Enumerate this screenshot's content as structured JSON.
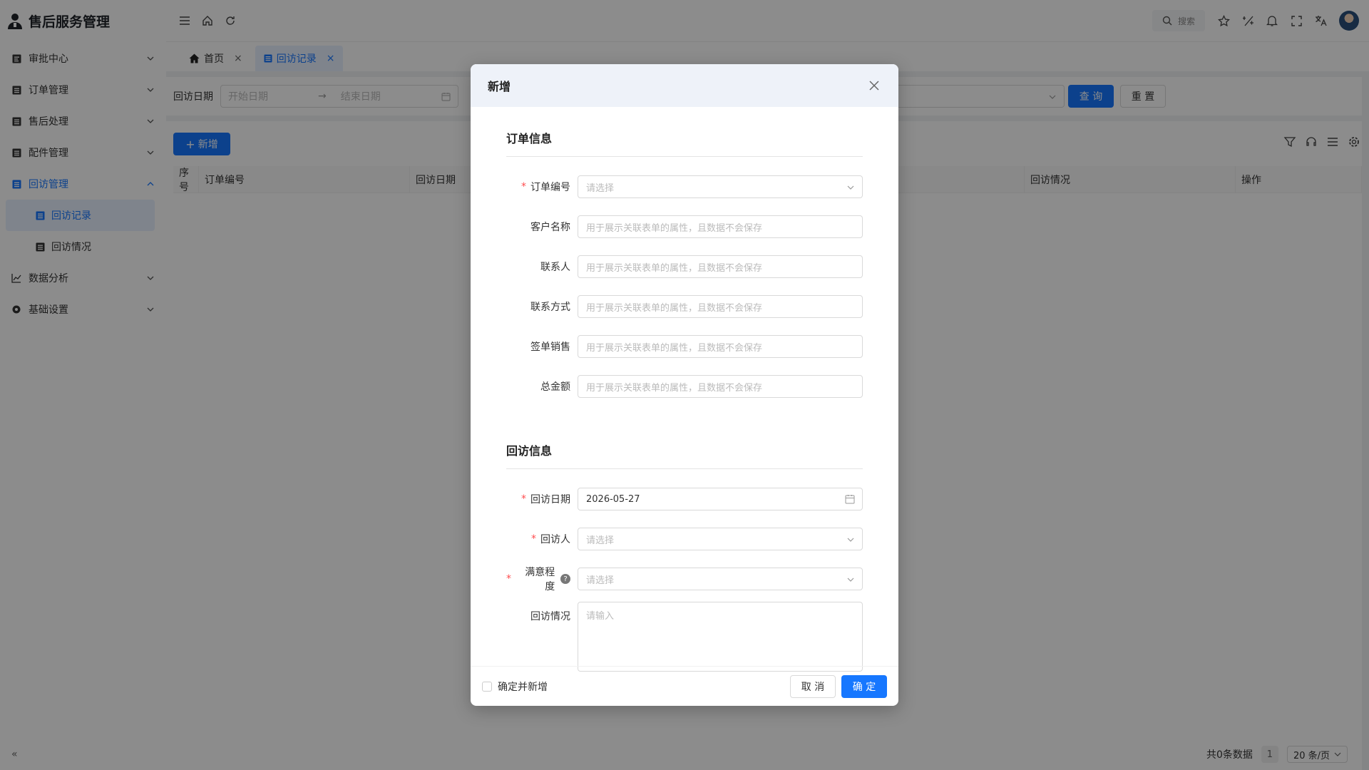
{
  "app": {
    "title": "售后服务管理"
  },
  "sidebar": {
    "items": [
      {
        "label": "审批中心",
        "icon": "approval-icon"
      },
      {
        "label": "订单管理",
        "icon": "document-icon"
      },
      {
        "label": "售后处理",
        "icon": "document-icon"
      },
      {
        "label": "配件管理",
        "icon": "document-icon"
      },
      {
        "label": "回访管理",
        "icon": "document-icon",
        "open": true,
        "children": [
          {
            "label": "回访记录",
            "active": true
          },
          {
            "label": "回访情况",
            "active": false
          }
        ]
      },
      {
        "label": "数据分析",
        "icon": "chart-icon"
      },
      {
        "label": "基础设置",
        "icon": "gear-icon"
      }
    ],
    "collapse_glyph": "«"
  },
  "header": {
    "search_label": "搜索"
  },
  "tabs": [
    {
      "label": "首页",
      "icon": "home-icon",
      "active": false,
      "close": "×"
    },
    {
      "label": "回访记录",
      "icon": "document-icon",
      "active": true,
      "close": "×"
    }
  ],
  "filter": {
    "date_label": "回访日期",
    "start_placeholder": "开始日期",
    "end_placeholder": "结束日期",
    "range_arrow": "→",
    "query_button": "查 询",
    "reset_button": "重 置"
  },
  "table": {
    "add_button": "新增",
    "columns": [
      "序号",
      "订单编号",
      "回访日期",
      "回访情况",
      "操作"
    ]
  },
  "pagination": {
    "total_text": "共0条数据",
    "page": "1",
    "page_size": "20 条/页"
  },
  "modal": {
    "title": "新增",
    "section_order": "订单信息",
    "section_visit": "回访信息",
    "fields": {
      "order_no": {
        "label": "订单编号",
        "placeholder": "请选择",
        "required": true
      },
      "customer": {
        "label": "客户名称",
        "placeholder": "用于展示关联表单的属性，且数据不会保存"
      },
      "contact": {
        "label": "联系人",
        "placeholder": "用于展示关联表单的属性，且数据不会保存"
      },
      "phone": {
        "label": "联系方式",
        "placeholder": "用于展示关联表单的属性，且数据不会保存"
      },
      "sales": {
        "label": "签单销售",
        "placeholder": "用于展示关联表单的属性，且数据不会保存"
      },
      "amount": {
        "label": "总金额",
        "placeholder": "用于展示关联表单的属性，且数据不会保存"
      },
      "visit_date": {
        "label": "回访日期",
        "value": "2026-05-27",
        "required": true
      },
      "visitor": {
        "label": "回访人",
        "placeholder": "请选择",
        "required": true
      },
      "satisfaction": {
        "label": "满意程度",
        "placeholder": "请选择",
        "required": true,
        "help": "?"
      },
      "visit_notes": {
        "label": "回访情况",
        "placeholder": "请输入"
      }
    },
    "confirm_and_add": "确定并新增",
    "cancel_button": "取 消",
    "ok_button": "确 定"
  },
  "colors": {
    "primary": "#1677ff",
    "required": "#ff4d4f"
  }
}
